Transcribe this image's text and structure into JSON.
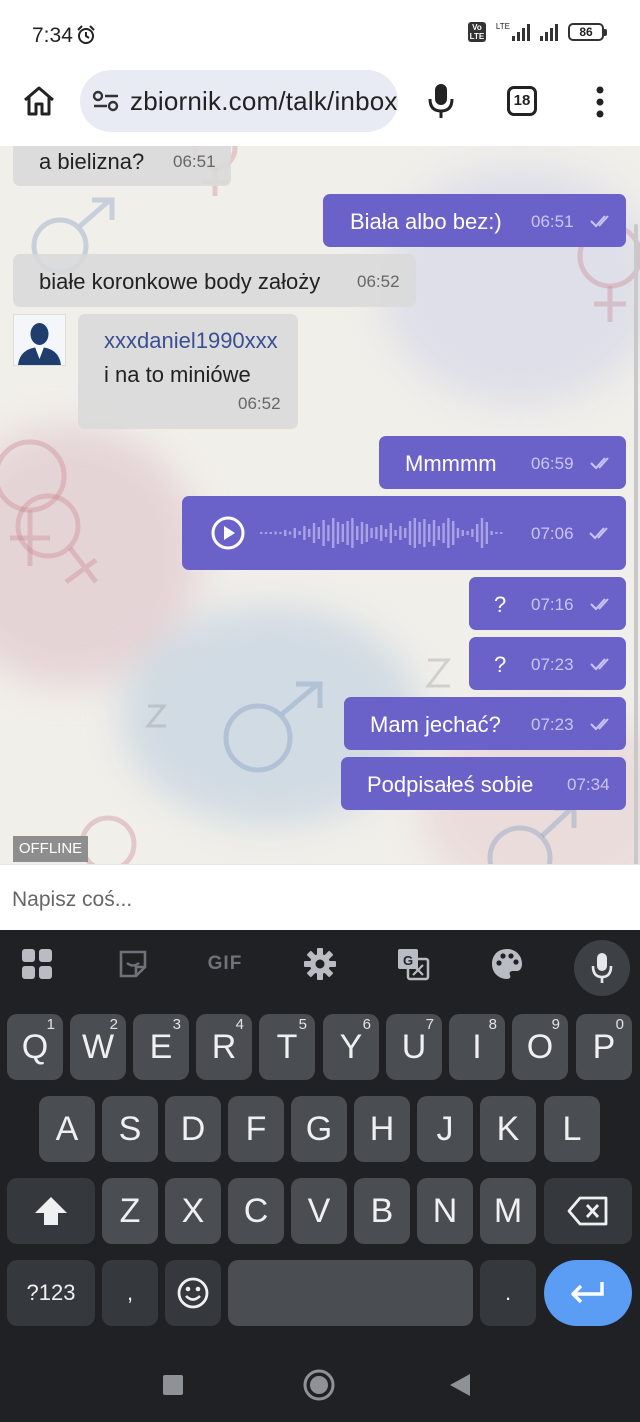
{
  "status": {
    "time": "7:34",
    "battery": "86",
    "volte_label": "Vo\nLTE",
    "lte_label": "LTE"
  },
  "browser": {
    "url": "zbiornik.com/talk/inbox",
    "tab_count": "18"
  },
  "chat": {
    "messages": [
      {
        "dir": "in",
        "text": "a bielizna?",
        "time": "06:51"
      },
      {
        "dir": "out",
        "text": "Biała albo bez:)",
        "time": "06:51"
      },
      {
        "dir": "in",
        "text": "białe koronkowe body założy",
        "time": "06:52"
      },
      {
        "dir": "in",
        "sender": "xxxdaniel1990xxx",
        "text": "i na to miniówe",
        "time": "06:52"
      },
      {
        "dir": "out",
        "text": "Mmmmm",
        "time": "06:59"
      },
      {
        "dir": "out",
        "type": "voice",
        "time": "07:06"
      },
      {
        "dir": "out",
        "text": "?",
        "time": "07:16"
      },
      {
        "dir": "out",
        "text": "?",
        "time": "07:23"
      },
      {
        "dir": "out",
        "text": "Mam jechać?",
        "time": "07:23"
      },
      {
        "dir": "out",
        "text": "Podpisałeś sobie",
        "time": "07:34"
      }
    ],
    "status_badge": "OFFLINE",
    "input_placeholder": "Napisz coś..."
  },
  "keyboard": {
    "toolbar": [
      "apps-grid-icon",
      "sticker-icon",
      "gif-icon",
      "settings-gear-icon",
      "translate-icon",
      "theme-palette-icon",
      "microphone-icon"
    ],
    "gif_label": "GIF",
    "row1": [
      "Q",
      "W",
      "E",
      "R",
      "T",
      "Y",
      "U",
      "I",
      "O",
      "P"
    ],
    "row1_numbers": [
      "1",
      "2",
      "3",
      "4",
      "5",
      "6",
      "7",
      "8",
      "9",
      "0"
    ],
    "row2": [
      "A",
      "S",
      "D",
      "F",
      "G",
      "H",
      "J",
      "K",
      "L"
    ],
    "row3": [
      "Z",
      "X",
      "C",
      "V",
      "B",
      "N",
      "M"
    ],
    "symbols_label": "?123",
    "comma": ",",
    "period": "."
  },
  "colors": {
    "outgoing_bubble": "#6b62c9",
    "incoming_bubble": "#dadada",
    "enter_key": "#5b9df5",
    "keyboard_bg": "#1f2124"
  }
}
